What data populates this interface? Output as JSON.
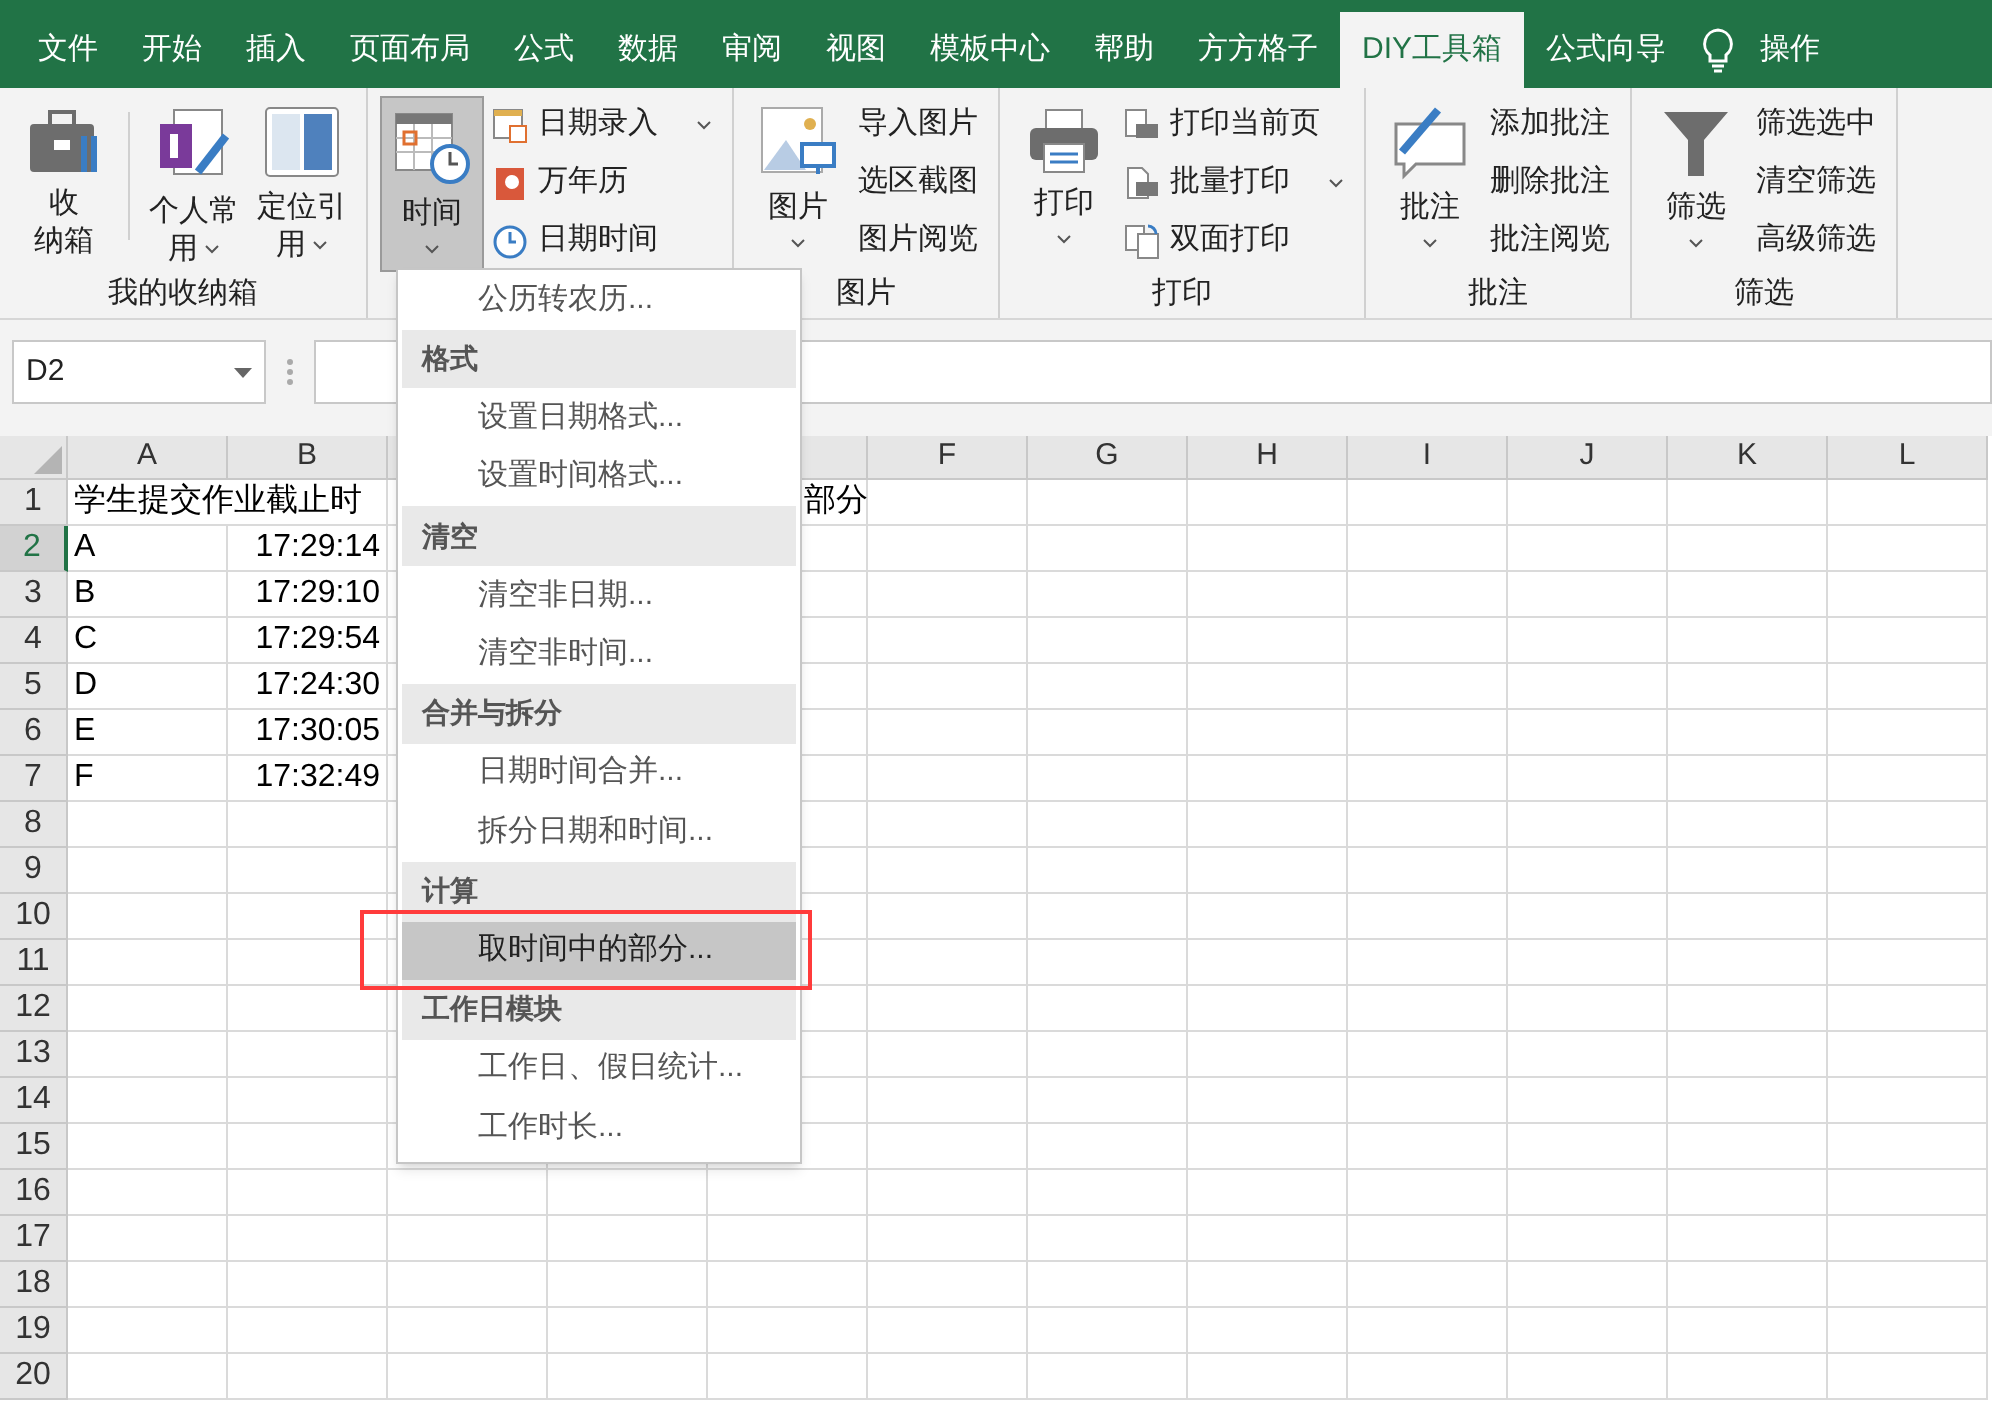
{
  "ribbon_tabs": [
    {
      "label": "文件",
      "selected": false
    },
    {
      "label": "开始",
      "selected": false
    },
    {
      "label": "插入",
      "selected": false
    },
    {
      "label": "页面布局",
      "selected": false
    },
    {
      "label": "公式",
      "selected": false
    },
    {
      "label": "数据",
      "selected": false
    },
    {
      "label": "审阅",
      "selected": false
    },
    {
      "label": "视图",
      "selected": false
    },
    {
      "label": "模板中心",
      "selected": false
    },
    {
      "label": "帮助",
      "selected": false
    },
    {
      "label": "方方格子",
      "selected": false
    },
    {
      "label": "DIY工具箱",
      "selected": true
    },
    {
      "label": "公式向导",
      "selected": false
    }
  ],
  "tell_me": "操作",
  "ribbon_groups": [
    {
      "label": "我的收纳箱",
      "large": [
        {
          "lines": [
            "收",
            "纳箱"
          ],
          "dropdown": false,
          "pressed": false
        },
        {
          "lines": [
            "个人常",
            "用"
          ],
          "dropdown": true,
          "pressed": false
        },
        {
          "lines": [
            "定位引",
            "用"
          ],
          "dropdown": true,
          "pressed": false
        }
      ]
    },
    {
      "large": [
        {
          "lines": [
            "时间"
          ],
          "dropdown": true,
          "pressed": true
        }
      ],
      "small": [
        {
          "label": "日期录入",
          "dropdown": true
        },
        {
          "label": "万年历",
          "dropdown": false
        },
        {
          "label": "日期时间",
          "dropdown": false
        }
      ]
    },
    {
      "label": "图片",
      "large": [
        {
          "lines": [
            "图片"
          ],
          "dropdown": true,
          "pressed": false
        }
      ],
      "small": [
        {
          "label": "导入图片",
          "dropdown": false
        },
        {
          "label": "选区截图",
          "dropdown": false
        },
        {
          "label": "图片阅览",
          "dropdown": false
        }
      ]
    },
    {
      "label": "打印",
      "large": [
        {
          "lines": [
            "打印"
          ],
          "dropdown": true,
          "pressed": false
        }
      ],
      "small": [
        {
          "label": "打印当前页",
          "dropdown": false
        },
        {
          "label": "批量打印",
          "dropdown": true
        },
        {
          "label": "双面打印",
          "dropdown": false
        }
      ]
    },
    {
      "label": "批注",
      "large": [
        {
          "lines": [
            "批注"
          ],
          "dropdown": true,
          "pressed": false
        }
      ],
      "small": [
        {
          "label": "添加批注",
          "dropdown": false
        },
        {
          "label": "删除批注",
          "dropdown": false
        },
        {
          "label": "批注阅览",
          "dropdown": false
        }
      ]
    },
    {
      "label": "筛选",
      "large": [
        {
          "lines": [
            "筛选"
          ],
          "dropdown": true,
          "pressed": false
        }
      ],
      "small": [
        {
          "label": "筛选选中",
          "dropdown": false
        },
        {
          "label": "清空筛选",
          "dropdown": false
        },
        {
          "label": "高级筛选",
          "dropdown": false
        }
      ]
    }
  ],
  "name_box": "D2",
  "sheet": {
    "columns_left": [
      "A",
      "B"
    ],
    "columns_right": [
      "F",
      "G",
      "H",
      "I",
      "J",
      "K",
      "L"
    ],
    "title_text": "学生提交作业截止时",
    "title_tail": "部分",
    "rows": [
      {
        "header": "1",
        "selected": false,
        "cells": []
      },
      {
        "header": "2",
        "selected": true,
        "cells": [
          "A",
          "17:29:14"
        ]
      },
      {
        "header": "3",
        "selected": false,
        "cells": [
          "B",
          "17:29:10"
        ]
      },
      {
        "header": "4",
        "selected": false,
        "cells": [
          "C",
          "17:29:54"
        ]
      },
      {
        "header": "5",
        "selected": false,
        "cells": [
          "D",
          "17:24:30"
        ]
      },
      {
        "header": "6",
        "selected": false,
        "cells": [
          "E",
          "17:30:05"
        ]
      },
      {
        "header": "7",
        "selected": false,
        "cells": [
          "F",
          "17:32:49"
        ]
      },
      {
        "header": "8",
        "selected": false,
        "cells": []
      },
      {
        "header": "9",
        "selected": false,
        "cells": []
      },
      {
        "header": "10",
        "selected": false,
        "cells": []
      },
      {
        "header": "11",
        "selected": false,
        "cells": []
      },
      {
        "header": "12",
        "selected": false,
        "cells": []
      },
      {
        "header": "13",
        "selected": false,
        "cells": []
      },
      {
        "header": "14",
        "selected": false,
        "cells": []
      },
      {
        "header": "15",
        "selected": false,
        "cells": []
      },
      {
        "header": "16",
        "selected": false,
        "cells": []
      },
      {
        "header": "17",
        "selected": false,
        "cells": []
      },
      {
        "header": "18",
        "selected": false,
        "cells": []
      },
      {
        "header": "19",
        "selected": false,
        "cells": []
      },
      {
        "header": "20",
        "selected": false,
        "cells": []
      }
    ]
  },
  "time_menu": [
    {
      "kind": "item",
      "label": "公历转农历...",
      "selected": false
    },
    {
      "kind": "header",
      "label": "格式"
    },
    {
      "kind": "item",
      "label": "设置日期格式...",
      "selected": false
    },
    {
      "kind": "item",
      "label": "设置时间格式...",
      "selected": false
    },
    {
      "kind": "header",
      "label": "清空"
    },
    {
      "kind": "item",
      "label": "清空非日期...",
      "selected": false
    },
    {
      "kind": "item",
      "label": "清空非时间...",
      "selected": false
    },
    {
      "kind": "header",
      "label": "合并与拆分"
    },
    {
      "kind": "item",
      "label": "日期时间合并...",
      "selected": false
    },
    {
      "kind": "item",
      "label": "拆分日期和时间...",
      "selected": false
    },
    {
      "kind": "header",
      "label": "计算"
    },
    {
      "kind": "item",
      "label": "取时间中的部分...",
      "selected": true,
      "annotated": true
    },
    {
      "kind": "header",
      "label": "工作日模块"
    },
    {
      "kind": "item",
      "label": "工作日、假日统计...",
      "selected": false
    },
    {
      "kind": "item",
      "label": "工作时长...",
      "selected": false
    }
  ]
}
